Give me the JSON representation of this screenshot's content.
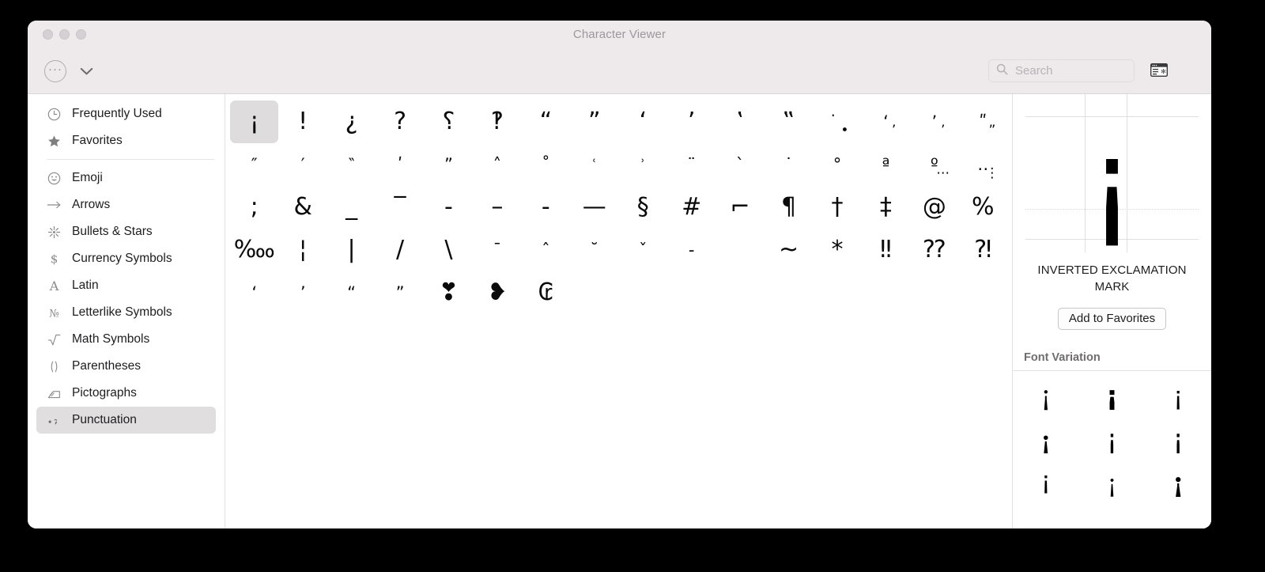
{
  "window": {
    "title": "Character Viewer",
    "traffic_lights": [
      "close-button",
      "minimize-button",
      "zoom-button"
    ]
  },
  "toolbar": {
    "more_label": "···",
    "chevron_icon": "chevron-down-icon",
    "search": {
      "placeholder": "Search",
      "value": "",
      "icon": "search-icon"
    },
    "viewer_toggle_icon": "character-viewer-panel-icon"
  },
  "sidebar": {
    "items": [
      {
        "label": "Frequently Used",
        "icon": "clock-icon",
        "selected": false
      },
      {
        "label": "Favorites",
        "icon": "star-icon",
        "selected": false
      },
      {
        "label": "Emoji",
        "icon": "smiley-icon",
        "selected": false
      },
      {
        "label": "Arrows",
        "icon": "arrow-right-icon",
        "selected": false
      },
      {
        "label": "Bullets & Stars",
        "icon": "sparkle-icon",
        "selected": false
      },
      {
        "label": "Currency Symbols",
        "icon": "dollar-icon",
        "selected": false
      },
      {
        "label": "Latin",
        "icon": "letter-a-icon",
        "selected": false
      },
      {
        "label": "Letterlike Symbols",
        "icon": "numero-icon",
        "selected": false
      },
      {
        "label": "Math Symbols",
        "icon": "radical-icon",
        "selected": false
      },
      {
        "label": "Parentheses",
        "icon": "parentheses-icon",
        "selected": false
      },
      {
        "label": "Pictographs",
        "icon": "pictograph-icon",
        "selected": false
      },
      {
        "label": "Punctuation",
        "icon": "punctuation-icon",
        "selected": true
      }
    ],
    "separator_after_index": 1
  },
  "grid": {
    "columns": 16,
    "selected_index": 0,
    "cells": [
      {
        "char": "¡",
        "size": "normal"
      },
      {
        "char": "!",
        "size": "normal"
      },
      {
        "char": "¿",
        "size": "normal"
      },
      {
        "char": "?",
        "size": "normal"
      },
      {
        "char": "⸮",
        "size": "normal"
      },
      {
        "char": "‽",
        "size": "normal"
      },
      {
        "char": "“",
        "size": "normal"
      },
      {
        "char": "”",
        "size": "normal"
      },
      {
        "char": "‘",
        "size": "normal"
      },
      {
        "char": "’",
        "size": "normal"
      },
      {
        "char": "‛",
        "size": "normal"
      },
      {
        "char": "‟",
        "size": "normal"
      },
      {
        "char": "̇",
        "size": "small"
      },
      {
        "char": "ʻ",
        "size": "small"
      },
      {
        "char": "ʼ",
        "size": "small"
      },
      {
        "char": "ʺ",
        "size": "small"
      },
      {
        "char": "″",
        "size": "small"
      },
      {
        "char": "′",
        "size": "small"
      },
      {
        "char": "‶",
        "size": "small"
      },
      {
        "char": "ʹ",
        "size": "small"
      },
      {
        "char": "ˮ",
        "size": "small"
      },
      {
        "char": "˄",
        "size": "small"
      },
      {
        "char": "˚",
        "size": "small"
      },
      {
        "char": "ʿ",
        "size": "tiny"
      },
      {
        "char": "ʾ",
        "size": "tiny"
      },
      {
        "char": "¨",
        "size": "small"
      },
      {
        "char": "`",
        "size": "small"
      },
      {
        "char": "˙",
        "size": "small"
      },
      {
        "char": "°",
        "size": "small"
      },
      {
        "char": "ª",
        "size": "small"
      },
      {
        "char": "º",
        "size": "small"
      },
      {
        "char": "‥",
        "size": "small"
      },
      {
        "char": ";",
        "size": "normal"
      },
      {
        "char": "&",
        "size": "normal"
      },
      {
        "char": "_",
        "size": "normal"
      },
      {
        "char": "‾",
        "size": "normal"
      },
      {
        "char": "‐",
        "size": "normal"
      },
      {
        "char": "–",
        "size": "normal"
      },
      {
        "char": "‑",
        "size": "normal"
      },
      {
        "char": "—",
        "size": "normal"
      },
      {
        "char": "§",
        "size": "normal"
      },
      {
        "char": "#",
        "size": "normal"
      },
      {
        "char": "⌐",
        "size": "normal"
      },
      {
        "char": "¶",
        "size": "normal"
      },
      {
        "char": "†",
        "size": "normal"
      },
      {
        "char": "‡",
        "size": "normal"
      },
      {
        "char": "@",
        "size": "normal"
      },
      {
        "char": "%",
        "size": "normal"
      },
      {
        "char": "‱",
        "size": "normal"
      },
      {
        "char": "¦",
        "size": "normal"
      },
      {
        "char": "|",
        "size": "normal"
      },
      {
        "char": "/",
        "size": "normal"
      },
      {
        "char": "\\",
        "size": "normal"
      },
      {
        "char": "¯",
        "size": "small"
      },
      {
        "char": "ˆ",
        "size": "small"
      },
      {
        "char": "˘",
        "size": "small"
      },
      {
        "char": "ˇ",
        "size": "small"
      },
      {
        "char": "-",
        "size": "small"
      },
      {
        "char": "­",
        "size": "small"
      },
      {
        "char": "~",
        "size": "normal"
      },
      {
        "char": "*",
        "size": "normal"
      },
      {
        "char": "‼",
        "size": "normal"
      },
      {
        "char": "⁇",
        "size": "normal"
      },
      {
        "char": "⁈",
        "size": "normal"
      },
      {
        "char": "‘",
        "size": "small"
      },
      {
        "char": "’",
        "size": "small"
      },
      {
        "char": "“",
        "size": "small"
      },
      {
        "char": "”",
        "size": "small"
      },
      {
        "char": "❣",
        "size": "normal"
      },
      {
        "char": "❥",
        "size": "normal"
      },
      {
        "char": "₢",
        "size": "normal"
      },
      {
        "char": "",
        "size": "normal"
      },
      {
        "char": "",
        "size": "normal"
      },
      {
        "char": "",
        "size": "normal"
      },
      {
        "char": "",
        "size": "normal"
      },
      {
        "char": "",
        "size": "normal"
      },
      {
        "char": "",
        "size": "normal"
      },
      {
        "char": "",
        "size": "normal"
      },
      {
        "char": "",
        "size": "normal"
      },
      {
        "char": "",
        "size": "normal"
      }
    ],
    "row2_extra": [
      {
        "col": 12,
        "char": "•"
      },
      {
        "col": 13,
        "char": "’"
      },
      {
        "col": 14,
        "char": "’"
      },
      {
        "col": 15,
        "char": "”"
      }
    ],
    "row3_extra": [
      {
        "col": 14,
        "char": "⋯"
      },
      {
        "col": 15,
        "char": "⋮"
      }
    ]
  },
  "detail": {
    "preview_char": "¡",
    "character_name": "INVERTED EXCLAMATION MARK",
    "add_to_favorites_label": "Add to Favorites",
    "font_variation_header": "Font Variation",
    "font_variations": [
      "¡",
      "¡",
      "¡",
      "¡",
      "¡",
      "¡",
      "¡",
      "¡",
      "¡"
    ]
  },
  "colors": {
    "titlebar": "#eeeaec",
    "selection": "#dedcdd",
    "sidebar_selection": "#e0dedf",
    "text": "#1d1d1f",
    "muted_text": "#9b989c",
    "divider": "#e3e1e2",
    "desktop": "#000000"
  }
}
